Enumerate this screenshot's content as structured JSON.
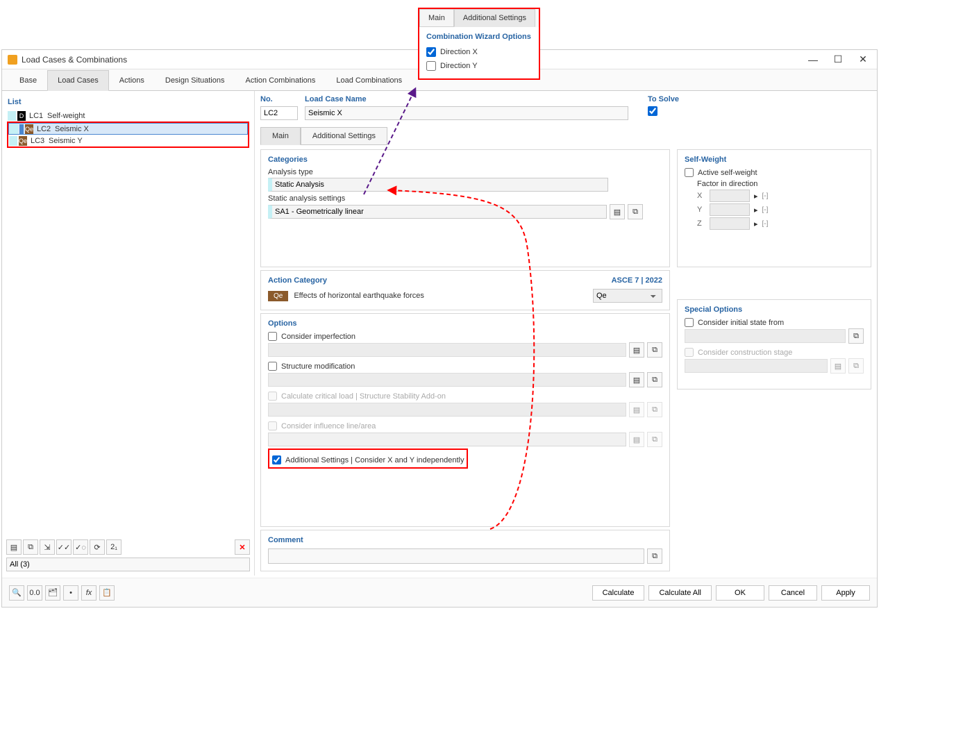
{
  "popup": {
    "tabs": [
      "Main",
      "Additional Settings"
    ],
    "active_tab": 1,
    "title": "Combination Wizard Options",
    "dir_x": "Direction X",
    "dir_y": "Direction Y",
    "dir_x_checked": true,
    "dir_y_checked": false
  },
  "window": {
    "title": "Load Cases & Combinations",
    "tabs": [
      "Base",
      "Load Cases",
      "Actions",
      "Design Situations",
      "Action Combinations",
      "Load Combinations"
    ],
    "active_tab": 1
  },
  "list": {
    "header": "List",
    "items": [
      {
        "badge_type": "D",
        "badge_val": "D",
        "no": "LC1",
        "name": "Self-weight"
      },
      {
        "badge_type": "Qe",
        "badge_val": "Qe",
        "no": "LC2",
        "name": "Seismic X",
        "selected": true
      },
      {
        "badge_type": "Qe",
        "badge_val": "Qe",
        "no": "LC3",
        "name": "Seismic Y"
      }
    ],
    "filter": "All (3)"
  },
  "detail": {
    "no_label": "No.",
    "no_value": "LC2",
    "name_label": "Load Case Name",
    "name_value": "Seismic X",
    "solve_label": "To Solve",
    "solve_checked": true,
    "tabs": [
      "Main",
      "Additional Settings"
    ],
    "active_tab": 0
  },
  "categories": {
    "title": "Categories",
    "analysis_type_label": "Analysis type",
    "analysis_type_value": "Static Analysis",
    "static_settings_label": "Static analysis settings",
    "static_settings_value": "SA1 - Geometrically linear"
  },
  "self_weight": {
    "title": "Self-Weight",
    "active_label": "Active self-weight",
    "factor_label": "Factor in direction",
    "axes": [
      "X",
      "Y",
      "Z"
    ],
    "unit": "[-]"
  },
  "action_category": {
    "title": "Action Category",
    "standard": "ASCE 7 | 2022",
    "badge": "Qe",
    "desc": "Effects of horizontal earthquake forces",
    "sel_value": "Qe"
  },
  "options": {
    "title": "Options",
    "imperfection": "Consider imperfection",
    "structure_mod": "Structure modification",
    "critical": "Calculate critical load | Structure Stability Add-on",
    "influence": "Consider influence line/area",
    "additional": "Additional Settings | Consider X and Y independently",
    "additional_checked": true
  },
  "special": {
    "title": "Special Options",
    "initial_state": "Consider initial state from",
    "construction_stage": "Consider construction stage"
  },
  "comment": {
    "title": "Comment"
  },
  "footer": {
    "calculate": "Calculate",
    "calculate_all": "Calculate All",
    "ok": "OK",
    "cancel": "Cancel",
    "apply": "Apply"
  }
}
